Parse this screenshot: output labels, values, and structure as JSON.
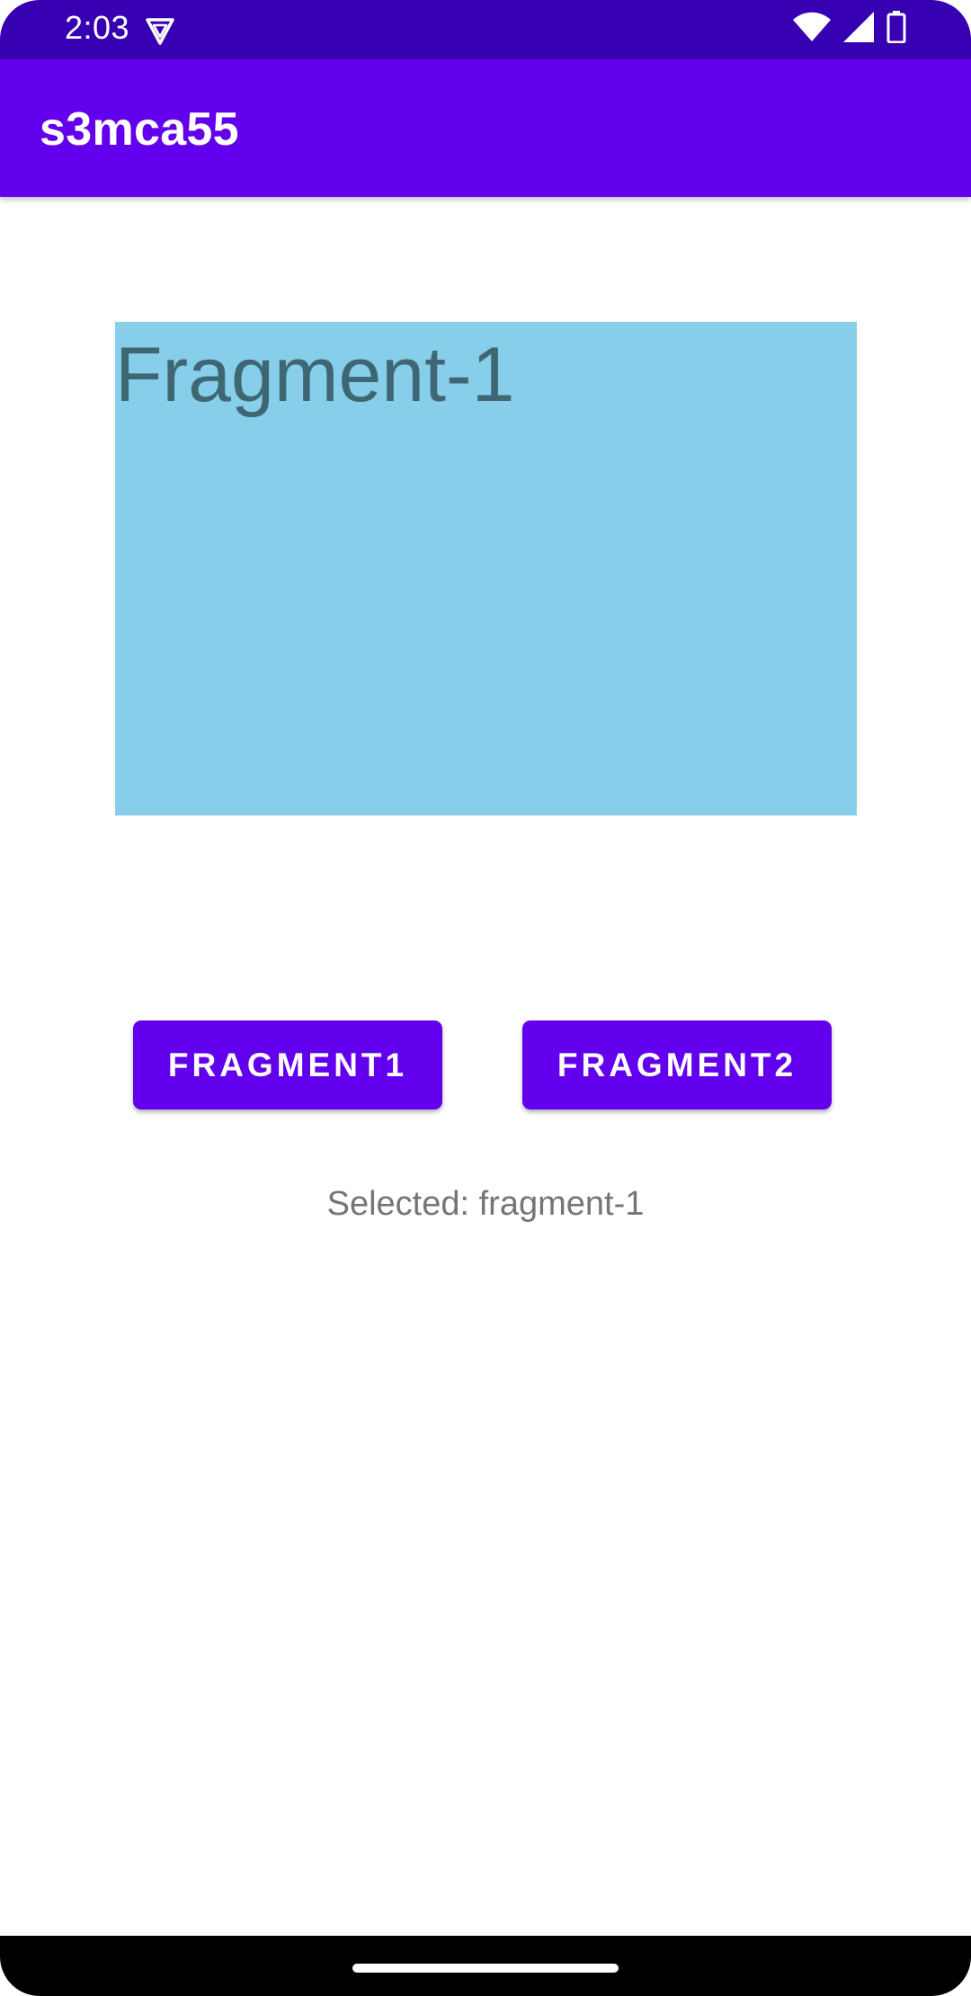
{
  "status_bar": {
    "time": "2:03",
    "icons": [
      "vpn-key-icon",
      "wifi-icon",
      "cellular-signal-icon",
      "battery-icon"
    ],
    "background_color": "#3700b3"
  },
  "app_bar": {
    "title": "s3mca55",
    "background_color": "#6200ee"
  },
  "fragment": {
    "label": "Fragment-1",
    "background_color": "#87ceeb"
  },
  "buttons": {
    "fragment1_label": "FRAGMENT1",
    "fragment2_label": "FRAGMENT2",
    "color": "#6200ee"
  },
  "selection": {
    "text": "Selected: fragment-1"
  },
  "nav_bar": {
    "icons": [
      "home-handle"
    ]
  }
}
